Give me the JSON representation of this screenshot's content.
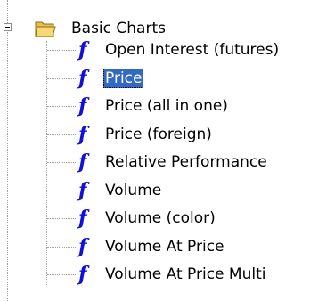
{
  "tree": {
    "folder": {
      "label": "Basic Charts",
      "icon": "folder-open-icon",
      "expanded": true
    },
    "items": [
      {
        "label": "Open Interest (futures)",
        "icon": "function-icon",
        "selected": false
      },
      {
        "label": "Price",
        "icon": "function-icon",
        "selected": true
      },
      {
        "label": "Price (all in one)",
        "icon": "function-icon",
        "selected": false
      },
      {
        "label": "Price (foreign)",
        "icon": "function-icon",
        "selected": false
      },
      {
        "label": "Relative Performance",
        "icon": "function-icon",
        "selected": false
      },
      {
        "label": "Volume",
        "icon": "function-icon",
        "selected": false
      },
      {
        "label": "Volume (color)",
        "icon": "function-icon",
        "selected": false
      },
      {
        "label": "Volume At Price",
        "icon": "function-icon",
        "selected": false
      },
      {
        "label": "Volume At Price Multi",
        "icon": "function-icon",
        "selected": false
      }
    ],
    "function_glyph": "f"
  },
  "colors": {
    "selection": "#316ac5",
    "function_icon": "#1010d8",
    "folder": "#f8d775"
  }
}
